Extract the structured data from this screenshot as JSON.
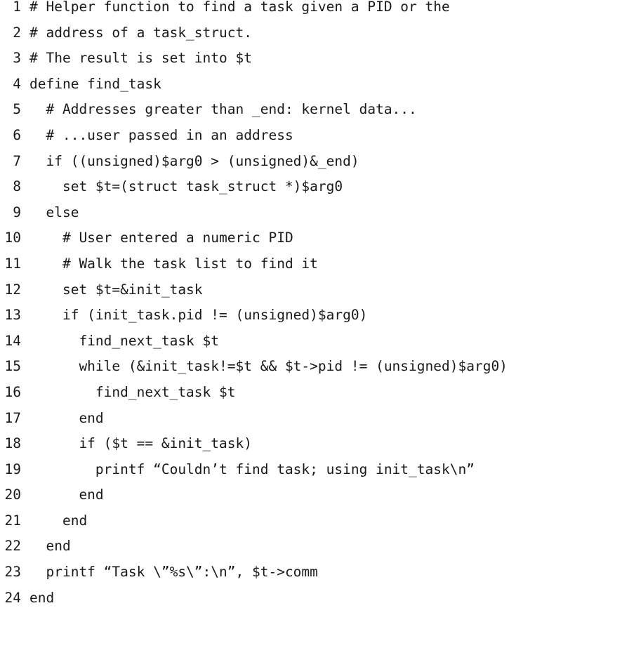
{
  "code": {
    "lines": [
      {
        "number": "1",
        "text": "# Helper function to find a task given a PID or the"
      },
      {
        "number": "2",
        "text": "# address of a task_struct."
      },
      {
        "number": "3",
        "text": "# The result is set into $t"
      },
      {
        "number": "4",
        "text": "define find_task"
      },
      {
        "number": "5",
        "text": "  # Addresses greater than _end: kernel data..."
      },
      {
        "number": "6",
        "text": "  # ...user passed in an address"
      },
      {
        "number": "7",
        "text": "  if ((unsigned)$arg0 > (unsigned)&_end)"
      },
      {
        "number": "8",
        "text": "    set $t=(struct task_struct *)$arg0"
      },
      {
        "number": "9",
        "text": "  else"
      },
      {
        "number": "10",
        "text": "    # User entered a numeric PID"
      },
      {
        "number": "11",
        "text": "    # Walk the task list to find it"
      },
      {
        "number": "12",
        "text": "    set $t=&init_task"
      },
      {
        "number": "13",
        "text": "    if (init_task.pid != (unsigned)$arg0)"
      },
      {
        "number": "14",
        "text": "      find_next_task $t"
      },
      {
        "number": "15",
        "text": "      while (&init_task!=$t && $t->pid != (unsigned)$arg0)"
      },
      {
        "number": "16",
        "text": "        find_next_task $t"
      },
      {
        "number": "17",
        "text": "      end"
      },
      {
        "number": "18",
        "text": "      if ($t == &init_task)"
      },
      {
        "number": "19",
        "text": "        printf “Couldn’t find task; using init_task\\n”"
      },
      {
        "number": "20",
        "text": "      end"
      },
      {
        "number": "21",
        "text": "    end"
      },
      {
        "number": "22",
        "text": "  end"
      },
      {
        "number": "23",
        "text": "  printf “Task \\”%s\\”:\\n”, $t->comm"
      },
      {
        "number": "24",
        "text": "end"
      }
    ]
  }
}
